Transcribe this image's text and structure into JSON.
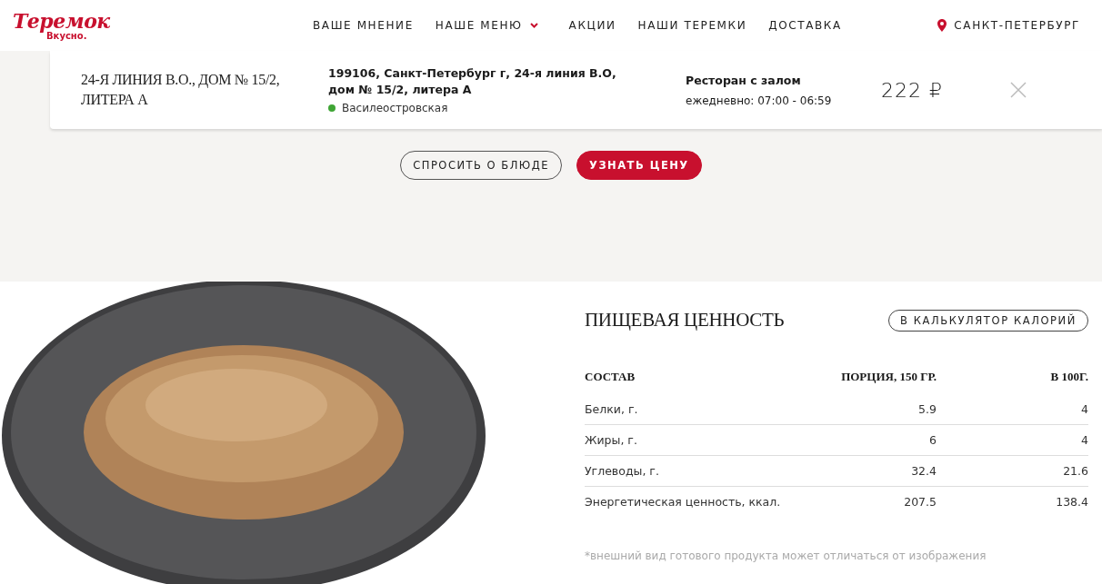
{
  "header": {
    "logo": {
      "name": "Теремок",
      "tagline": "Вкусно."
    },
    "nav": [
      {
        "label": "ВАШЕ МНЕНИЕ",
        "has_dropdown": false
      },
      {
        "label": "НАШЕ МЕНЮ",
        "has_dropdown": true
      },
      {
        "label": "АКЦИИ",
        "has_dropdown": false
      },
      {
        "label": "НАШИ ТЕРЕМКИ",
        "has_dropdown": false
      },
      {
        "label": "ДОСТАВКА",
        "has_dropdown": false
      }
    ],
    "city": "САНКТ-ПЕТЕРБУРГ"
  },
  "restaurant_card": {
    "title": "24-Я ЛИНИЯ В.О., ДОМ № 15/2, ЛИТЕРА А",
    "address": "199106, Санкт-Петербург г, 24-я линия В.О, дом № 15/2, литера А",
    "metro": {
      "name": "Василеостровская",
      "color": "#3fa535"
    },
    "type": "Ресторан с залом",
    "hours": "ежедневно: 07:00 - 06:59",
    "price": "222 ₽"
  },
  "actions": [
    {
      "label": "СПРОСИТЬ О БЛЮДЕ",
      "kind": "outline"
    },
    {
      "label": "УЗНАТЬ ЦЕНУ",
      "kind": "primary"
    }
  ],
  "nutrition": {
    "title": "ПИЩЕВАЯ ЦЕННОСТЬ",
    "calculator_button": "В КАЛЬКУЛЯТОР КАЛОРИЙ",
    "columns": [
      "СОСТАВ",
      "ПОРЦИЯ, 150 ГР.",
      "В 100Г."
    ],
    "rows": [
      [
        "Белки, г.",
        "5.9",
        "4"
      ],
      [
        "Жиры, г.",
        "6",
        "4"
      ],
      [
        "Углеводы, г.",
        "32.4",
        "21.6"
      ],
      [
        "Энергетическая ценность, ккал.",
        "207.5",
        "138.4"
      ]
    ],
    "note": "*внешний вид готового продукта может отличаться от изображения"
  }
}
